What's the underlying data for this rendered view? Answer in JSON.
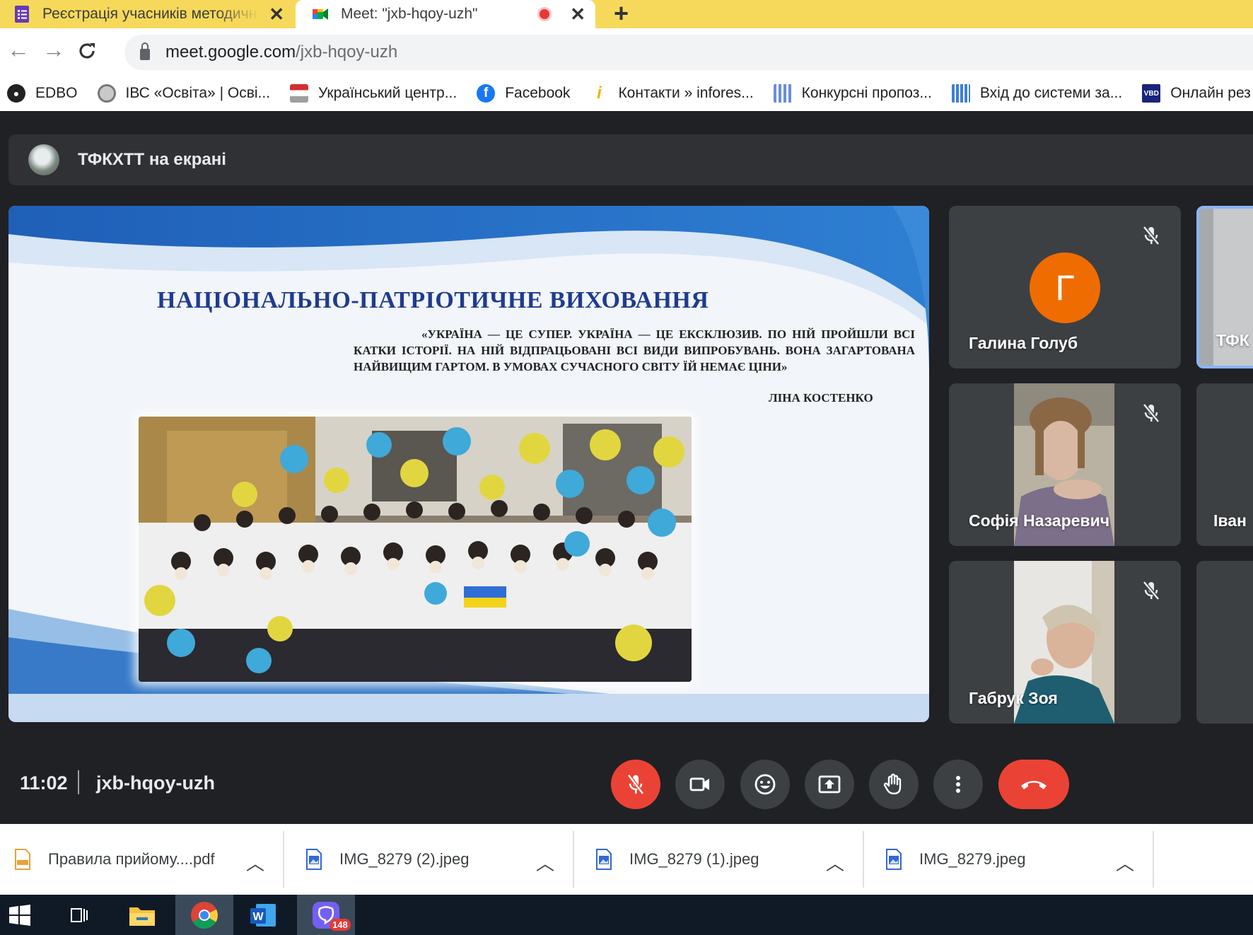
{
  "browser": {
    "tabs": [
      {
        "title": "Реєстрація учасників методичн",
        "active": false
      },
      {
        "title": "Meet: \"jxb-hqoy-uzh\"",
        "active": true
      }
    ],
    "url_host": "meet.google.com",
    "url_path": "/jxb-hqoy-uzh",
    "bookmarks": [
      {
        "label": "EDBO",
        "icon": "globe-icon"
      },
      {
        "label": "ІВС «Освіта» | Осві...",
        "icon": "emblem-icon"
      },
      {
        "label": "Український центр...",
        "icon": "book-icon"
      },
      {
        "label": "Facebook",
        "icon": "facebook-icon"
      },
      {
        "label": "Контакти » infores...",
        "icon": "info-icon"
      },
      {
        "label": "Конкурсні пропоз...",
        "icon": "chart-icon"
      },
      {
        "label": "Вхід до системи за...",
        "icon": "chart-icon"
      },
      {
        "label": "Онлайн рез",
        "icon": "vbd-icon"
      }
    ],
    "colors": {
      "tabstrip": "#f6d95a"
    }
  },
  "meet": {
    "presenter_label": "ТФКХТТ на екрані",
    "slide": {
      "title": "НАЦІОНАЛЬНО-ПАТРІОТИЧНЕ ВИХОВАННЯ",
      "quote": "«Україна — це супер. Україна — це ексклюзив. По ній пройшли всі катки історії. На ній відпрацьовані всі види випробувань. Вона загартована найвищим гартом. В умовах сучасного світу їй немає ціни»",
      "author": "ЛІНА КОСТЕНКО"
    },
    "participants": [
      {
        "name": "Галина Голуб",
        "initial": "Г",
        "muted": true
      },
      {
        "name": "Софія Назаревич",
        "muted": true
      },
      {
        "name": "Габрук Зоя",
        "muted": true
      },
      {
        "name": "ТФК",
        "muted": false
      },
      {
        "name": "Іван",
        "muted": false
      }
    ],
    "time": "11:02",
    "meeting_code": "jxb-hqoy-uzh",
    "controls": [
      "mic-off",
      "camera",
      "emoji",
      "present",
      "raise-hand",
      "more-options",
      "leave-call"
    ],
    "colors": {
      "danger": "#ea4335",
      "tile": "#3c4043"
    }
  },
  "downloads": [
    {
      "name": "Правила прийому....pdf",
      "type": "pdf"
    },
    {
      "name": "IMG_8279 (2).jpeg",
      "type": "image"
    },
    {
      "name": "IMG_8279 (1).jpeg",
      "type": "image"
    },
    {
      "name": "IMG_8279.jpeg",
      "type": "image"
    }
  ],
  "taskbar": {
    "apps": [
      "start",
      "task-view",
      "file-explorer",
      "chrome",
      "word",
      "viber"
    ],
    "viber_badge": "148"
  }
}
